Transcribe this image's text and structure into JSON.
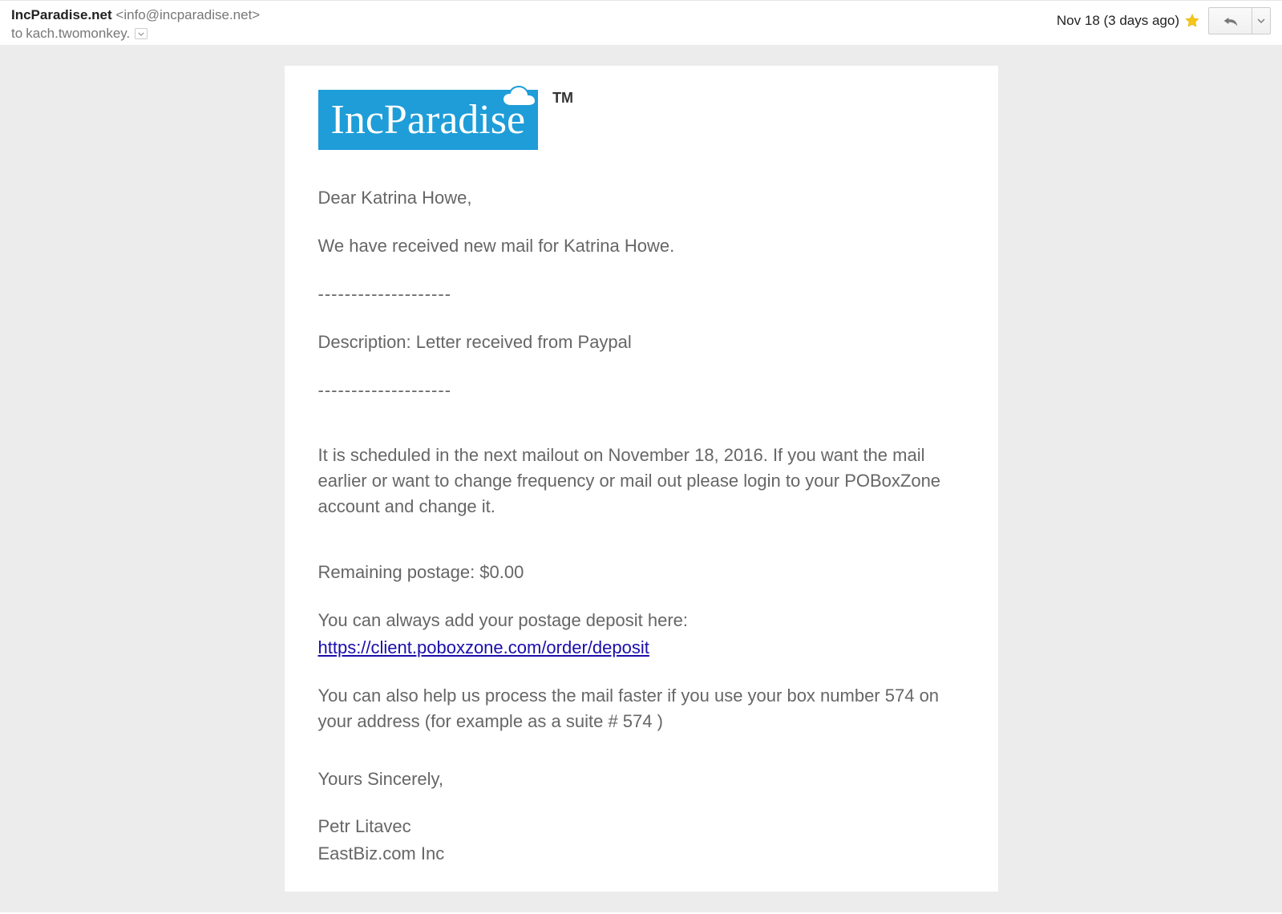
{
  "header": {
    "sender_name": "IncParadise.net",
    "sender_email": "<info@incparadise.net>",
    "to_label": "to",
    "recipient": "kach.twomonkey.",
    "date": "Nov 18 (3 days ago)"
  },
  "logo": {
    "text": "IncParadise",
    "trademark": "TM"
  },
  "body": {
    "greeting": "Dear Katrina Howe,",
    "line1": "We have received new mail for Katrina Howe.",
    "separator": "--------------------",
    "description": "Description: Letter received from Paypal",
    "schedule": "It is scheduled in the next mailout on November 18, 2016. If you want the mail earlier or want to change frequency or mail out please login to your POBoxZone account and change it.",
    "postage": "Remaining postage: $0.00",
    "deposit_intro": "You can always add your postage deposit here:",
    "deposit_link": "https://client.poboxzone.com/order/deposit",
    "box_tip": "You can also help us process the mail faster if you use your box number 574 on your address (for example as a suite # 574 )",
    "signoff": "Yours Sincerely,",
    "sig_name": "Petr Litavec",
    "sig_company": "EastBiz.com Inc"
  }
}
